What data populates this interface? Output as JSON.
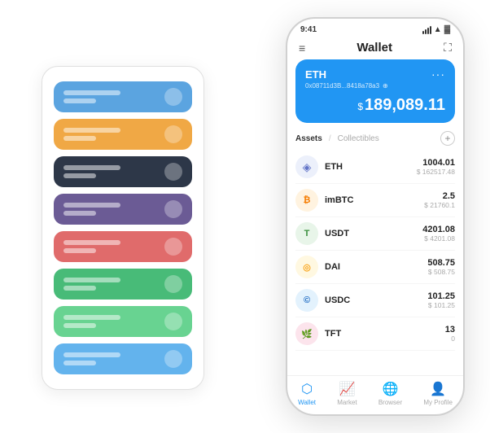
{
  "scene": {
    "background": "#ffffff"
  },
  "card_stack": {
    "cards": [
      {
        "color": "card-blue",
        "icon": "🔵"
      },
      {
        "color": "card-orange",
        "icon": "🟠"
      },
      {
        "color": "card-dark",
        "icon": "⚙️"
      },
      {
        "color": "card-purple",
        "icon": "🔮"
      },
      {
        "color": "card-red",
        "icon": "❤️"
      },
      {
        "color": "card-green",
        "icon": "💚"
      },
      {
        "color": "card-light-green",
        "icon": "🌿"
      },
      {
        "color": "card-sky",
        "icon": "💙"
      }
    ]
  },
  "phone": {
    "status_bar": {
      "time": "9:41",
      "battery": "▌"
    },
    "navbar": {
      "menu_icon": "≡",
      "title": "Wallet",
      "expand_icon": "⛶"
    },
    "eth_card": {
      "name": "ETH",
      "dots": "···",
      "address": "0x08711d3B...8418a78a3",
      "copy_icon": "⊕",
      "balance_symbol": "$",
      "balance": "189,089.11"
    },
    "assets": {
      "tab_active": "Assets",
      "divider": "/",
      "tab_inactive": "Collectibles",
      "add_icon": "+"
    },
    "asset_list": [
      {
        "name": "ETH",
        "amount": "1004.01",
        "usd": "$ 162517.48",
        "icon": "◈",
        "icon_class": "eth-icon-circle"
      },
      {
        "name": "imBTC",
        "amount": "2.5",
        "usd": "$ 21760.1",
        "icon": "₿",
        "icon_class": "imbtc-icon-circle"
      },
      {
        "name": "USDT",
        "amount": "4201.08",
        "usd": "$ 4201.08",
        "icon": "₮",
        "icon_class": "usdt-icon-circle"
      },
      {
        "name": "DAI",
        "amount": "508.75",
        "usd": "$ 508.75",
        "icon": "◎",
        "icon_class": "dai-icon-circle"
      },
      {
        "name": "USDC",
        "amount": "101.25",
        "usd": "$ 101.25",
        "icon": "©",
        "icon_class": "usdc-icon-circle"
      },
      {
        "name": "TFT",
        "amount": "13",
        "usd": "0",
        "icon": "🌿",
        "icon_class": "tft-icon-circle"
      }
    ],
    "bottom_nav": [
      {
        "label": "Wallet",
        "icon": "⬡",
        "active": true
      },
      {
        "label": "Market",
        "icon": "📊",
        "active": false
      },
      {
        "label": "Browser",
        "icon": "🌐",
        "active": false
      },
      {
        "label": "My Profile",
        "icon": "👤",
        "active": false
      }
    ]
  }
}
